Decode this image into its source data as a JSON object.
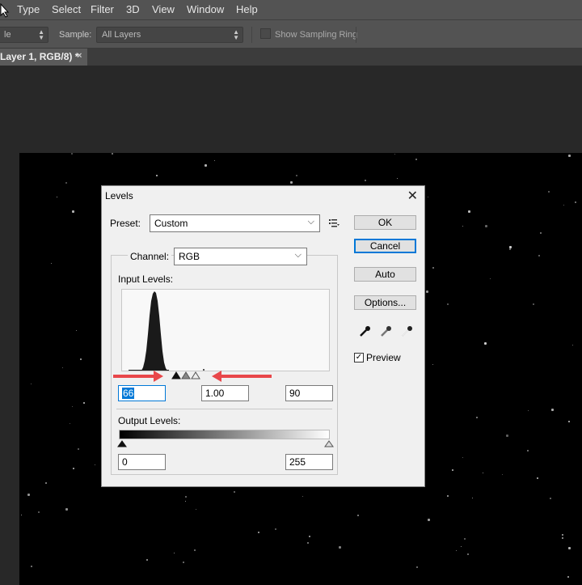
{
  "menubar": {
    "items": [
      "Type",
      "Select",
      "Filter",
      "3D",
      "View",
      "Window",
      "Help"
    ]
  },
  "options_bar": {
    "left_select_value": "le",
    "sample_label": "Sample:",
    "sample_value": "All Layers",
    "show_sampling_ring_label": "Show Sampling Ring"
  },
  "doc_tab": {
    "title": "Layer 1, RGB/8) *",
    "close": "×"
  },
  "levels_dialog": {
    "title": "Levels",
    "close": "✕",
    "preset_label": "Preset:",
    "preset_value": "Custom",
    "channel_label": "Channel:",
    "channel_value": "RGB",
    "input_levels_label": "Input Levels:",
    "input_black": "66",
    "input_gamma": "1.00",
    "input_white": "90",
    "output_levels_label": "Output Levels:",
    "output_black": "0",
    "output_white": "255",
    "buttons": {
      "ok": "OK",
      "cancel": "Cancel",
      "auto": "Auto",
      "options": "Options..."
    },
    "preview_label": "Preview",
    "preview_checked": true
  },
  "colors": {
    "annotation_arrow": "#e8474a",
    "dialog_bg": "#f0f0f0",
    "selection": "#0078d7"
  }
}
